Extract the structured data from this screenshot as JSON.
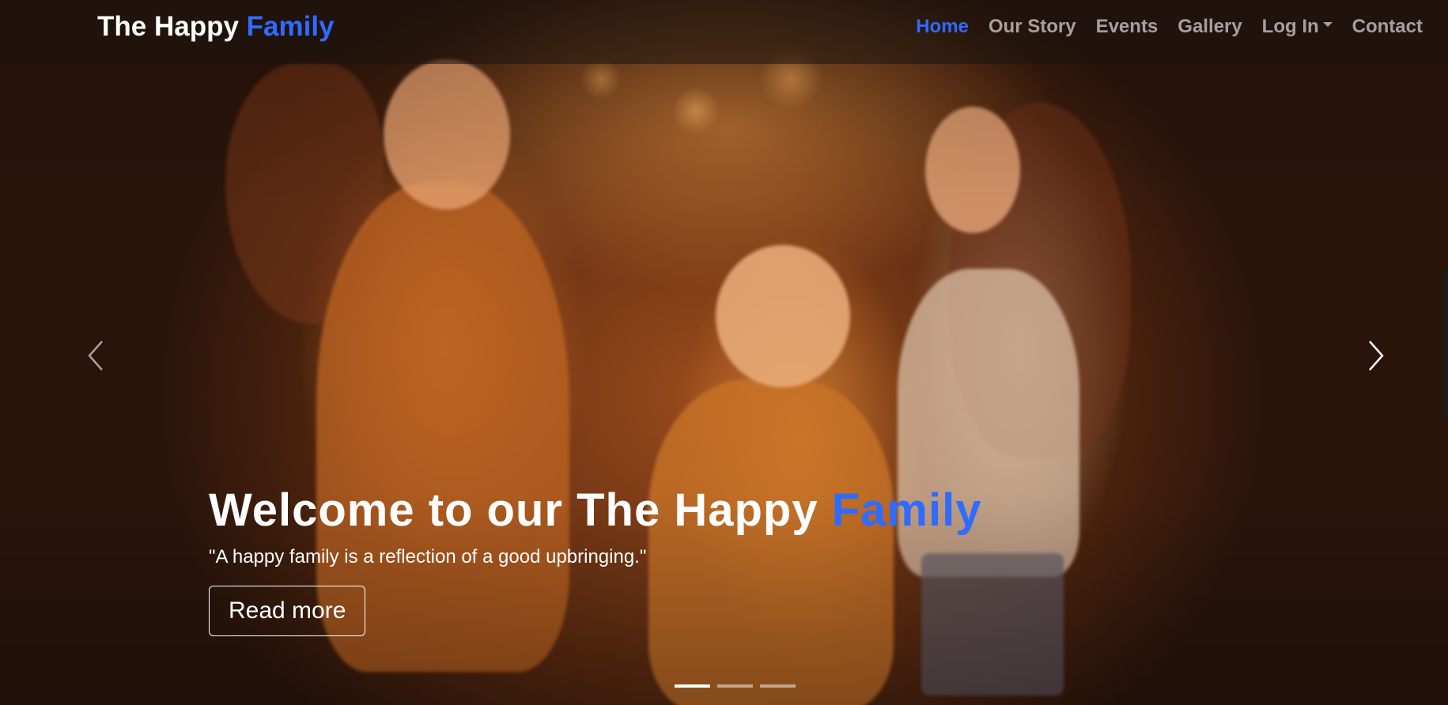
{
  "navbar": {
    "brand_main": "The Happy",
    "brand_accent": "Family",
    "links": [
      {
        "label": "Home",
        "active": true
      },
      {
        "label": "Our Story",
        "active": false
      },
      {
        "label": "Events",
        "active": false
      },
      {
        "label": "Gallery",
        "active": false
      },
      {
        "label": "Log In",
        "active": false,
        "dropdown": true
      },
      {
        "label": "Contact",
        "active": false
      }
    ]
  },
  "hero": {
    "title_main": "Welcome to our The Happy",
    "title_accent": "Family",
    "quote": "\"A happy family is a reflection of a good upbringing.\"",
    "button_label": "Read more",
    "slides_count": 3,
    "active_slide": 1
  },
  "colors": {
    "accent": "#2f6bff",
    "nav_text": "#ffffff99",
    "hero_tone": "#9a4b1c"
  },
  "icons": {
    "prev": "chevron-left-icon",
    "next": "chevron-right-icon",
    "dropdown": "caret-down-icon"
  }
}
